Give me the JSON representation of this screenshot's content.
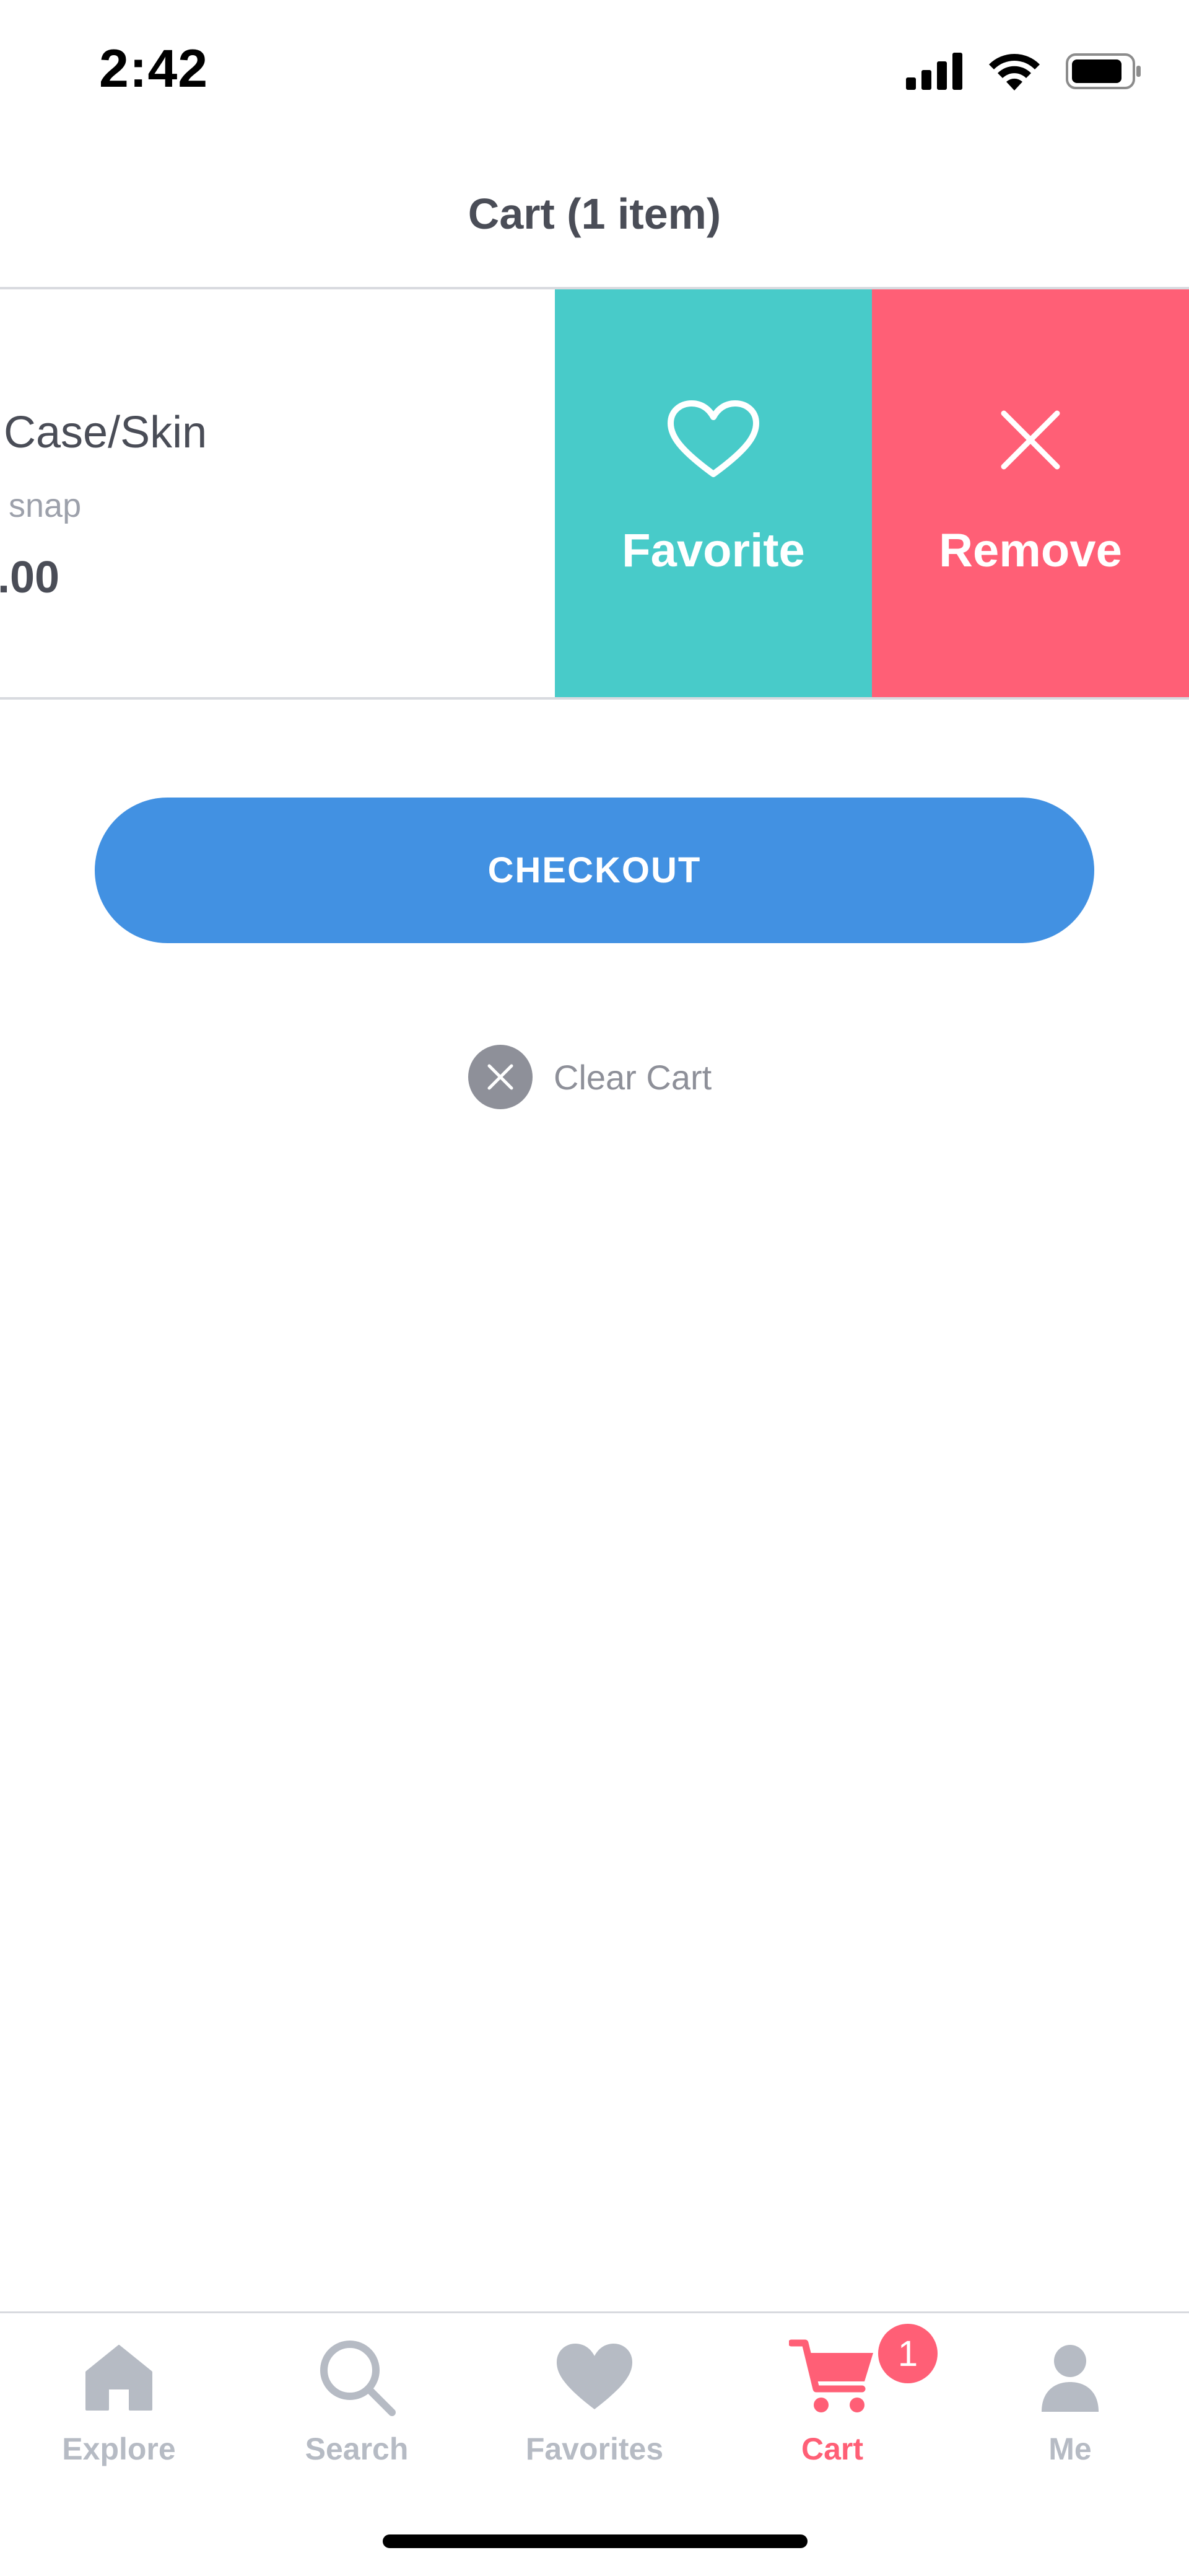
{
  "status_bar": {
    "time": "2:42"
  },
  "header": {
    "title": "Cart (1 item)"
  },
  "cart_item": {
    "name": "Case/Skin",
    "variant": "snap",
    "price": ".00"
  },
  "swipe_actions": {
    "favorite_label": "Favorite",
    "remove_label": "Remove",
    "favorite_color": "#48cbc9",
    "remove_color": "#ff5f76"
  },
  "checkout": {
    "label": "CHECKOUT",
    "color": "#4291e2"
  },
  "clear_cart": {
    "label": "Clear Cart"
  },
  "tab_bar": {
    "tabs": [
      {
        "label": "Explore",
        "icon": "home-icon"
      },
      {
        "label": "Search",
        "icon": "search-icon"
      },
      {
        "label": "Favorites",
        "icon": "heart-icon"
      },
      {
        "label": "Cart",
        "icon": "cart-icon",
        "active": true
      },
      {
        "label": "Me",
        "icon": "user-icon"
      }
    ],
    "cart_badge": "1",
    "active_color": "#ff5f76",
    "inactive_color": "#b6bbc4"
  }
}
